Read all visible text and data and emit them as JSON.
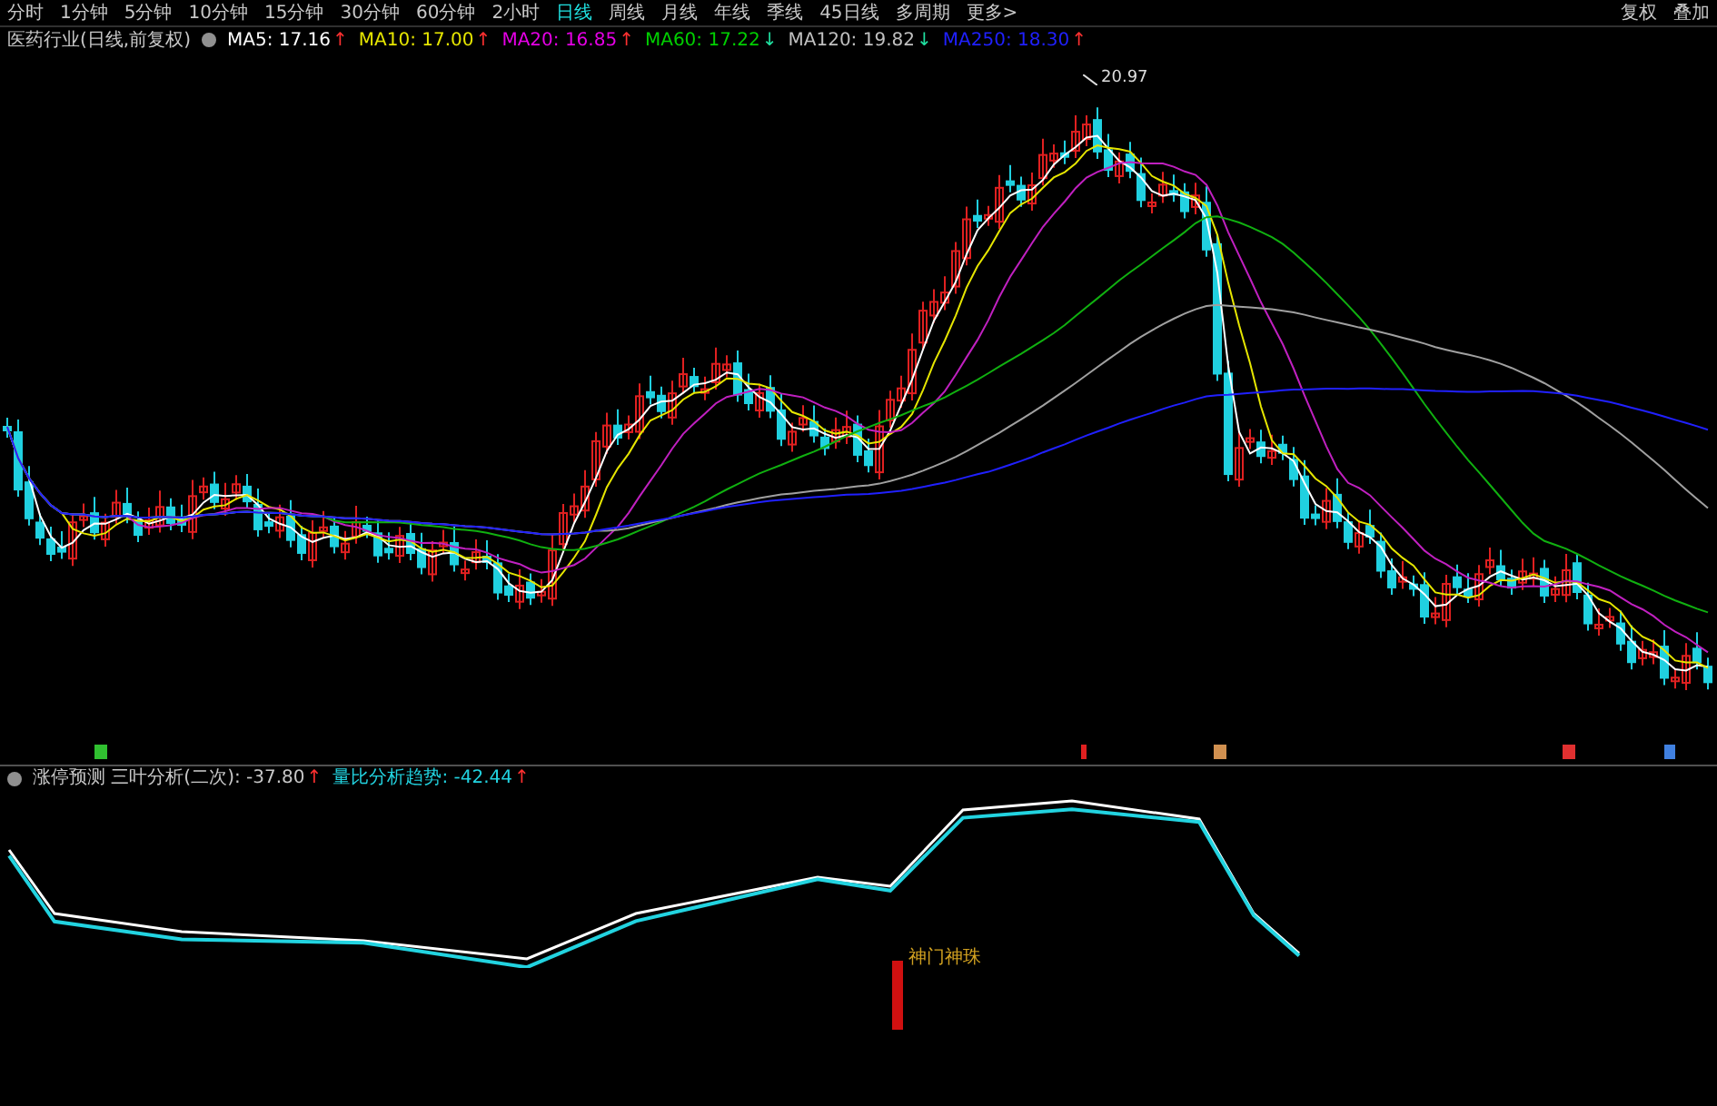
{
  "toolbar": {
    "periods": [
      {
        "label": "分时",
        "selected": false
      },
      {
        "label": "1分钟",
        "selected": false
      },
      {
        "label": "5分钟",
        "selected": false
      },
      {
        "label": "10分钟",
        "selected": false
      },
      {
        "label": "15分钟",
        "selected": false
      },
      {
        "label": "30分钟",
        "selected": false
      },
      {
        "label": "60分钟",
        "selected": false
      },
      {
        "label": "2小时",
        "selected": false
      },
      {
        "label": "日线",
        "selected": true
      },
      {
        "label": "周线",
        "selected": false
      },
      {
        "label": "月线",
        "selected": false
      },
      {
        "label": "年线",
        "selected": false
      },
      {
        "label": "季线",
        "selected": false
      },
      {
        "label": "45日线",
        "selected": false
      },
      {
        "label": "多周期",
        "selected": false
      },
      {
        "label": "更多>",
        "selected": false
      }
    ],
    "right_buttons": [
      "复权",
      "叠加"
    ]
  },
  "main_chart": {
    "title": "医药行业(日线,前复权)",
    "indicators": [
      {
        "name": "MA5:",
        "value": "17.16",
        "color": "#ffffff",
        "arrow": {
          "text": "↑",
          "color": "#ff3030"
        }
      },
      {
        "name": "MA10:",
        "value": "17.00",
        "color": "#e6e600",
        "arrow": {
          "text": "↑",
          "color": "#ff3030"
        }
      },
      {
        "name": "MA20:",
        "value": "16.85",
        "color": "#e600e6",
        "arrow": {
          "text": "↑",
          "color": "#ff3030"
        }
      },
      {
        "name": "MA60:",
        "value": "17.22",
        "color": "#00d000",
        "arrow": {
          "text": "↓",
          "color": "#20e0a0"
        }
      },
      {
        "name": "MA120:",
        "value": "19.82",
        "color": "#c0c0c0",
        "arrow": {
          "text": "↓",
          "color": "#20e0a0"
        }
      },
      {
        "name": "MA250:",
        "value": "18.30",
        "color": "#2020ff",
        "arrow": {
          "text": "↑",
          "color": "#ff3030"
        }
      }
    ],
    "peak_label": "20.97"
  },
  "sub_chart": {
    "title": "涨停预测 三叶分析(二次):",
    "value": "-37.80",
    "arrow": {
      "text": "↑",
      "color": "#ff3030"
    },
    "indicators": [
      {
        "name": "量比分析趋势:",
        "value": "-42.44",
        "color": "#22d3e0",
        "arrow": {
          "text": "↑",
          "color": "#ff3030"
        }
      }
    ],
    "signal_label": "神门神珠"
  }
}
